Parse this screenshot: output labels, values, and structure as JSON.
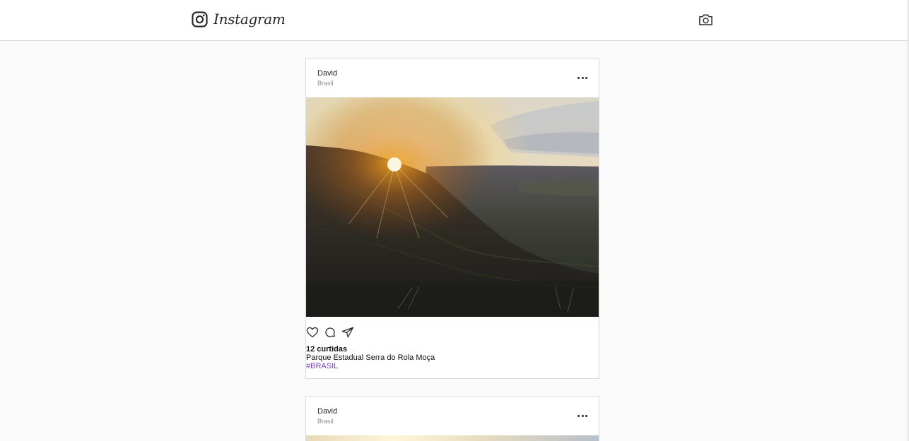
{
  "header": {
    "brand_name": "Instagram",
    "brand_icon": "instagram-glyph-icon",
    "camera_icon": "camera-icon"
  },
  "feed": {
    "posts": [
      {
        "username": "David",
        "location": "Brasil",
        "photo_alt": "sunset-over-mountain-valley",
        "likes": "12 curtidas",
        "caption": "Parque Estadual Serra do Rola Moça",
        "hashtag": "#BRASIL"
      },
      {
        "username": "David",
        "location": "Brasil"
      }
    ]
  },
  "colors": {
    "page_bg": "#fafafa",
    "card_bg": "#ffffff",
    "border": "#dbdbdb",
    "text": "#262626",
    "muted": "#8e8e8e",
    "hashtag": "#7b3fc4"
  }
}
